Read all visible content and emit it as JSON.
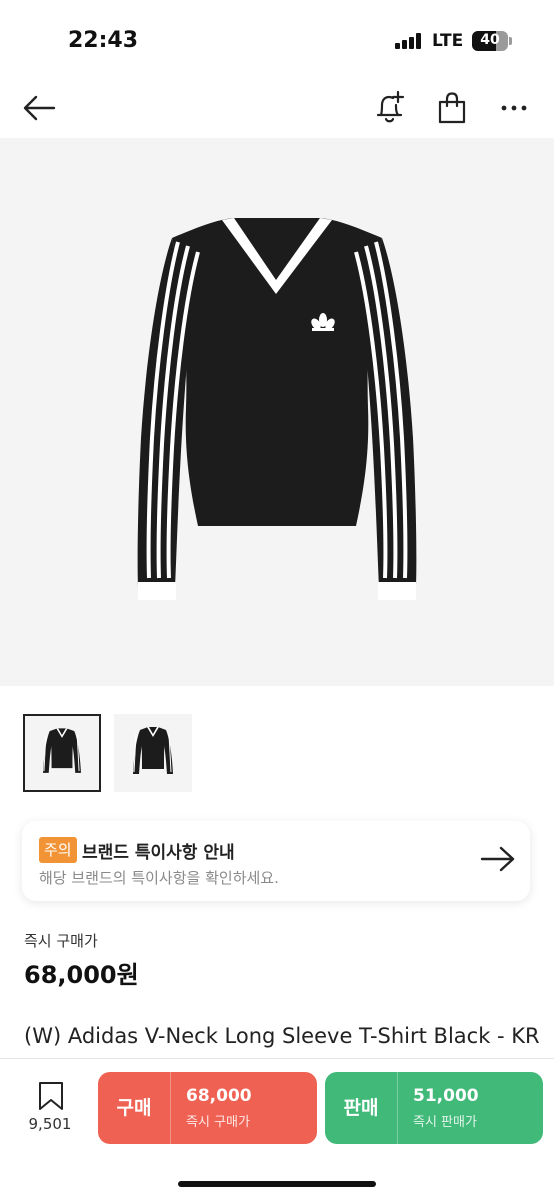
{
  "status": {
    "time": "22:43",
    "network": "LTE",
    "battery": "40"
  },
  "nav": {
    "back_icon": "arrow-left-icon",
    "alert_icon": "bell-plus-icon",
    "bag_icon": "shopping-bag-icon",
    "more_icon": "more-dots-icon"
  },
  "product_images": {
    "count": 2,
    "selected_index": 0
  },
  "notice": {
    "badge": "주의",
    "title": "브랜드 특이사항 안내",
    "subtitle": "해당 브랜드의 특이사항을 확인하세요.",
    "arrow_icon": "arrow-right-icon"
  },
  "price": {
    "label": "즉시 구매가",
    "value": "68,000원"
  },
  "product": {
    "name": "(W) Adidas V-Neck Long Sleeve T-Shirt Black - KR Sizing"
  },
  "bottom_bar": {
    "wish_count": "9,501",
    "buy": {
      "label": "구매",
      "price": "68,000",
      "sub": "즉시 구매가"
    },
    "sell": {
      "label": "판매",
      "price": "51,000",
      "sub": "즉시 판매가"
    }
  },
  "colors": {
    "buy": "#ef6253",
    "sell": "#41b979",
    "notice_badge": "#f29336"
  }
}
